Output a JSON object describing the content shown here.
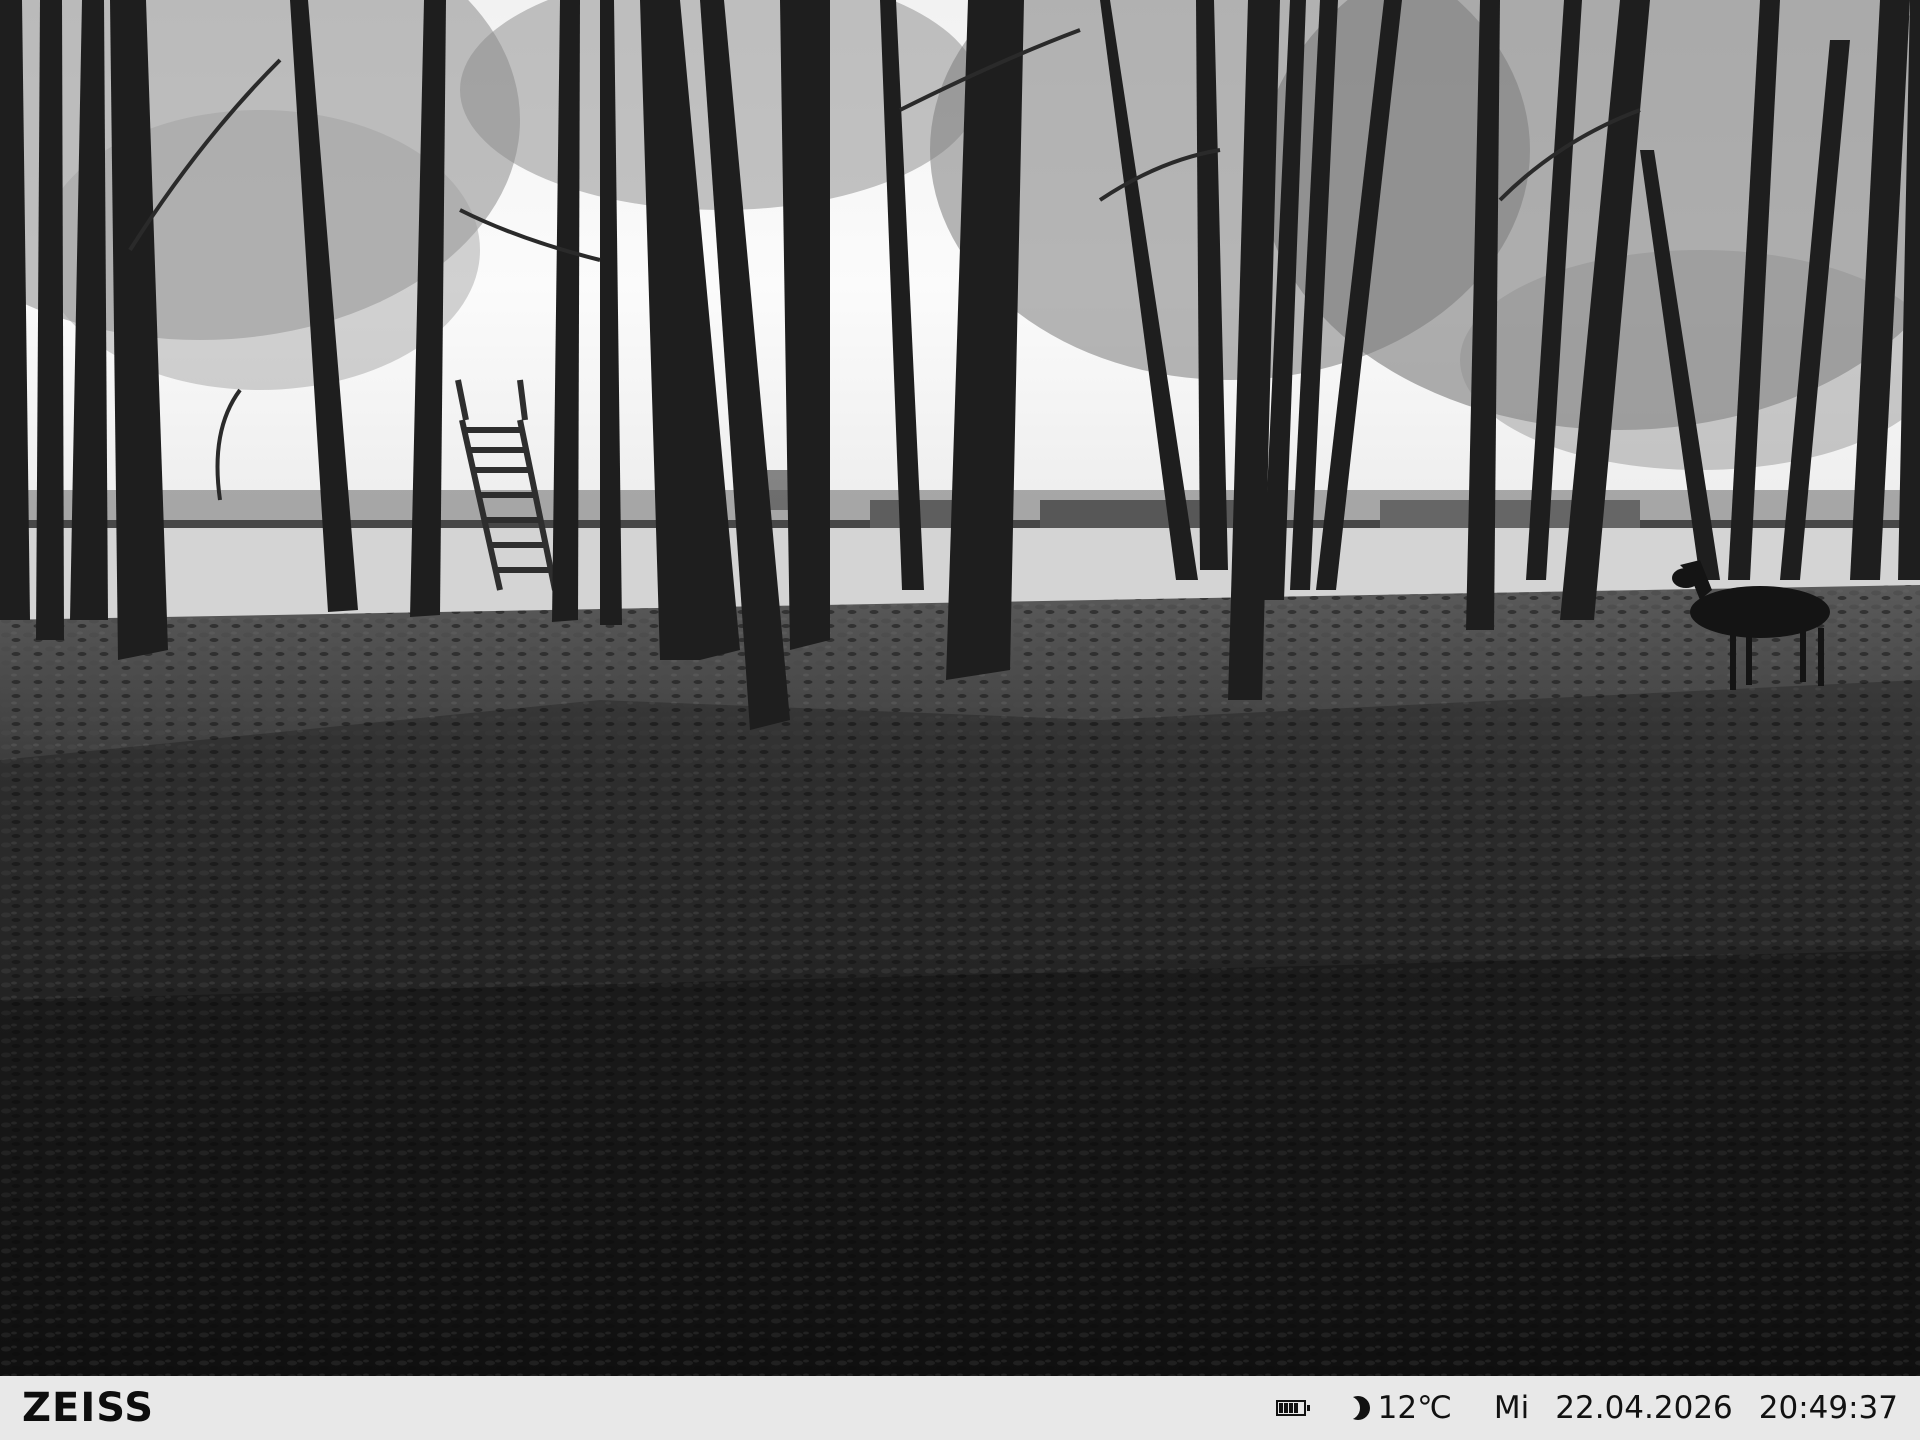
{
  "photo": {
    "scene": "trail camera night image"
  },
  "info_bar": {
    "brand": "ZEISS",
    "battery_icon": "battery-full-icon",
    "moon_icon": "moon-phase-icon",
    "temperature": "12℃",
    "weekday": "Mi",
    "date": "22.04.2026",
    "time": "20:49:37"
  },
  "colors": {
    "bar_background": "#e8e8e8",
    "bar_text": "#111111"
  }
}
